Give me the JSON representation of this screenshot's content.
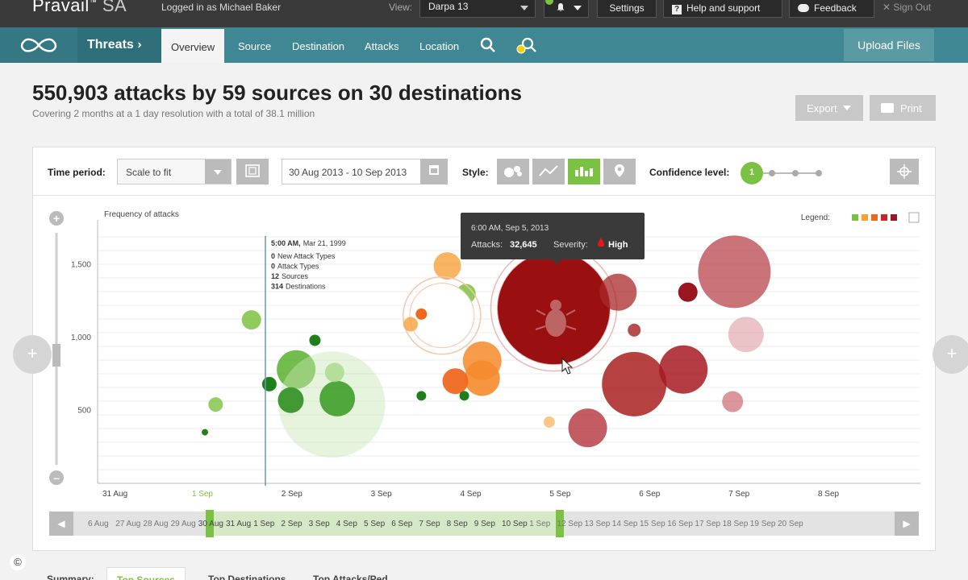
{
  "topbar": {
    "brand": "Pravail",
    "brand_suffix": "SA",
    "logged_in": "Logged in as Michael Baker",
    "view_label": "View:",
    "view_value": "Darpa 13",
    "settings": "Settings",
    "help": "Help and support",
    "feedback": "Feedback",
    "signout": "Sign Out"
  },
  "nav": {
    "section": "Threats",
    "tabs": [
      "Overview",
      "Source",
      "Destination",
      "Attacks",
      "Location"
    ],
    "upload": "Upload Files"
  },
  "summary": {
    "headline": "550,903 attacks by 59 sources on 30 destinations",
    "subline": "Covering 2 months at a 1 day resolution with a total of 38.1 million",
    "export": "Export",
    "print": "Print"
  },
  "controls": {
    "time_period_label": "Time period:",
    "time_period_value": "Scale to fit",
    "date_range": "30 Aug 2013 - 10 Sep 2013",
    "style_label": "Style:",
    "confidence_label": "Confidence level:",
    "confidence_value": "1"
  },
  "tooltip": {
    "time": "6:00 AM, Sep 5, 2013",
    "attacks_label": "Attacks:",
    "attacks_value": "32,645",
    "severity_label": "Severity:",
    "severity_value": "High"
  },
  "marker": {
    "time": "5:00 AM,",
    "date": "Mar 21, 1999",
    "lines": [
      {
        "num": "0",
        "text": "New Attack Types"
      },
      {
        "num": "0",
        "text": "Attack Types"
      },
      {
        "num": "12",
        "text": "Sources"
      },
      {
        "num": "314",
        "text": "Destinations"
      }
    ]
  },
  "chart_data": {
    "type": "scatter",
    "ylabel": "Frequency of attacks",
    "ylim": [
      0,
      1750
    ],
    "yticks": [
      500,
      1000,
      1500
    ],
    "x_tick_labels": [
      "31 Aug",
      "1 Sep",
      "2 Sep",
      "3 Sep",
      "4 Sep",
      "5 Sep",
      "6 Sep",
      "7 Sep",
      "8 Sep"
    ],
    "xlim": [
      0,
      9.2
    ],
    "legend_label": "Legend:",
    "legend_colors": [
      "#7cc242",
      "#f7a13b",
      "#f06820",
      "#c22a2a",
      "#9a1620"
    ],
    "points": [
      {
        "x": 1.72,
        "y": 1120,
        "r": 12,
        "c": "#7cc242",
        "o": 0.85
      },
      {
        "x": 2.22,
        "y": 780,
        "r": 24,
        "c": "#5ab02f",
        "o": 0.85
      },
      {
        "x": 2.62,
        "y": 540,
        "r": 66,
        "c": "#c8e6b4",
        "o": 0.45
      },
      {
        "x": 2.68,
        "y": 580,
        "r": 22,
        "c": "#3f9e2a",
        "o": 0.9
      },
      {
        "x": 2.16,
        "y": 570,
        "r": 16,
        "c": "#2f8f20",
        "o": 0.9
      },
      {
        "x": 1.92,
        "y": 680,
        "r": 9,
        "c": "#1f7f1a",
        "o": 1
      },
      {
        "x": 2.65,
        "y": 760,
        "r": 12,
        "c": "#a8d88a",
        "o": 0.8
      },
      {
        "x": 2.43,
        "y": 980,
        "r": 7,
        "c": "#1f7f1a",
        "o": 1
      },
      {
        "x": 1.32,
        "y": 540,
        "r": 9,
        "c": "#7cc242",
        "o": 0.8
      },
      {
        "x": 1.2,
        "y": 350,
        "r": 4,
        "c": "#1f7f1a",
        "o": 1
      },
      {
        "x": 3.91,
        "y": 1490,
        "r": 17,
        "c": "#f7a13b",
        "o": 0.8
      },
      {
        "x": 4.12,
        "y": 1300,
        "r": 12,
        "c": "#7cc242",
        "o": 0.85
      },
      {
        "x": 3.85,
        "y": 1150,
        "r": 40,
        "c": "#ffffff",
        "o": 1,
        "ring": "#f5c6a8"
      },
      {
        "x": 4.3,
        "y": 840,
        "r": 24,
        "c": "#f58b2c",
        "o": 0.85
      },
      {
        "x": 4.3,
        "y": 720,
        "r": 22,
        "c": "#f58b2c",
        "o": 0.9
      },
      {
        "x": 4.0,
        "y": 700,
        "r": 16,
        "c": "#f06820",
        "o": 0.95
      },
      {
        "x": 3.62,
        "y": 1160,
        "r": 7,
        "c": "#f06820",
        "o": 1
      },
      {
        "x": 3.5,
        "y": 1090,
        "r": 9,
        "c": "#f7a13b",
        "o": 0.8
      },
      {
        "x": 5.1,
        "y": 1200,
        "r": 70,
        "c": "#9a1010",
        "o": 1,
        "ring": "#e8b8b8"
      },
      {
        "x": 5.82,
        "y": 1310,
        "r": 23,
        "c": "#a82828",
        "o": 0.75
      },
      {
        "x": 6.0,
        "y": 680,
        "r": 40,
        "c": "#a82020",
        "o": 0.85
      },
      {
        "x": 6.55,
        "y": 780,
        "r": 30,
        "c": "#a81a22",
        "o": 0.85
      },
      {
        "x": 7.12,
        "y": 1450,
        "r": 45,
        "c": "#b8454d",
        "o": 0.75
      },
      {
        "x": 7.25,
        "y": 1020,
        "r": 22,
        "c": "#d88a90",
        "o": 0.5
      },
      {
        "x": 7.1,
        "y": 560,
        "r": 13,
        "c": "#cc6a72",
        "o": 0.7
      },
      {
        "x": 6.6,
        "y": 1310,
        "r": 12,
        "c": "#9a1620",
        "o": 1
      },
      {
        "x": 5.48,
        "y": 380,
        "r": 24,
        "c": "#b84048",
        "o": 0.85
      },
      {
        "x": 6.0,
        "y": 1050,
        "r": 8,
        "c": "#a82020",
        "o": 0.8
      },
      {
        "x": 5.05,
        "y": 420,
        "r": 7,
        "c": "#f7a13b",
        "o": 0.6
      },
      {
        "x": 4.1,
        "y": 600,
        "r": 6,
        "c": "#1f7f1a",
        "o": 1
      },
      {
        "x": 3.62,
        "y": 600,
        "r": 6,
        "c": "#1f7f1a",
        "o": 1
      }
    ]
  },
  "timeline": {
    "labels": [
      "6 Aug",
      "27 Aug",
      "28 Aug",
      "29 Aug",
      "30 Aug",
      "31 Aug",
      "1 Sep",
      "2 Sep",
      "3 Sep",
      "4 Sep",
      "5 Sep",
      "6 Sep",
      "7 Sep",
      "8 Sep",
      "9 Sep",
      "10 Sep",
      "1 Sep",
      "12 Sep",
      "13 Sep",
      "14 Sep",
      "15 Sep",
      "16 Sep",
      "17 Sep",
      "18 Sep",
      "19 Sep",
      "20 Sep"
    ],
    "selected_start": 4,
    "selected_end": 15
  },
  "bottom": {
    "summary_label": "Summary:",
    "tabs": [
      "Top Sources",
      "Top Destinations",
      "Top Attacks/Ped"
    ]
  }
}
